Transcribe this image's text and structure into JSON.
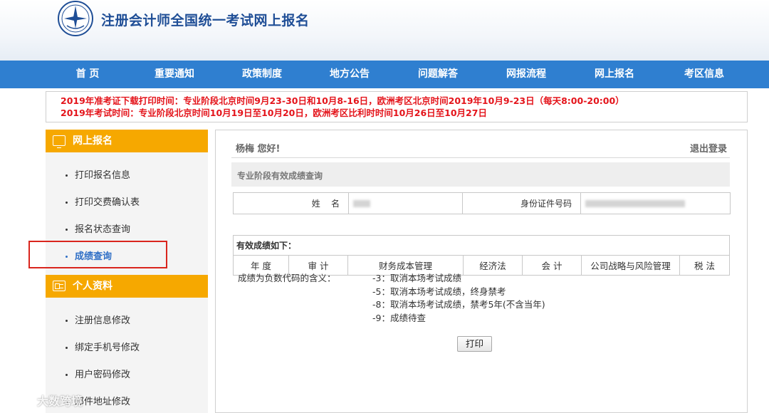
{
  "header": {
    "title": "注册会计师全国统一考试网上报名"
  },
  "nav": {
    "items": [
      "首 页",
      "重要通知",
      "政策制度",
      "地方公告",
      "问题解答",
      "网报流程",
      "网上报名",
      "考区信息"
    ]
  },
  "notice": {
    "line1": "2019年准考证下载打印时间：专业阶段北京时间9月23-30日和10月8-16日，欧洲考区北京时间2019年10月9-23日（每天8:00-20:00）",
    "line2": "2019年考试时间：专业阶段北京时间10月19日至10月20日，欧洲考区比利时时间10月26日至10月27日"
  },
  "sidebar": {
    "section1": {
      "title": "网上报名",
      "items": [
        "打印报名信息",
        "打印交费确认表",
        "报名状态查询",
        "成绩查询"
      ]
    },
    "section2": {
      "title": "个人资料",
      "items": [
        "注册信息修改",
        "绑定手机号修改",
        "用户密码修改",
        "邮件地址修改"
      ]
    },
    "active_item": "成绩查询"
  },
  "main": {
    "greeting": "杨梅 您好!",
    "logout": "退出登录",
    "section_title": "专业阶段有效成绩查询",
    "info": {
      "name_label": "姓    名",
      "id_label": "身份证件号码"
    },
    "scores": {
      "caption": "有效成绩如下：",
      "headers": [
        "年 度",
        "审 计",
        "财务成本管理",
        "经济法",
        "会 计",
        "公司战略与风险管理",
        "税 法"
      ]
    },
    "legend": {
      "label": "成绩为负数代码的含义：",
      "items": [
        "-3：取消本场考试成绩",
        "-5：取消本场考试成绩，终身禁考",
        "-8：取消本场考试成绩，禁考5年(不含当年)",
        "-9：成绩待查"
      ]
    },
    "print_button": "打印"
  },
  "watermark": {
    "text": "大数跨境"
  },
  "colors": {
    "nav_bg": "#2f7fd0",
    "sidebar_header": "#f6a800",
    "notice_text": "#e4141b",
    "highlight": "#d9251d",
    "active_link": "#2f6fc6"
  }
}
